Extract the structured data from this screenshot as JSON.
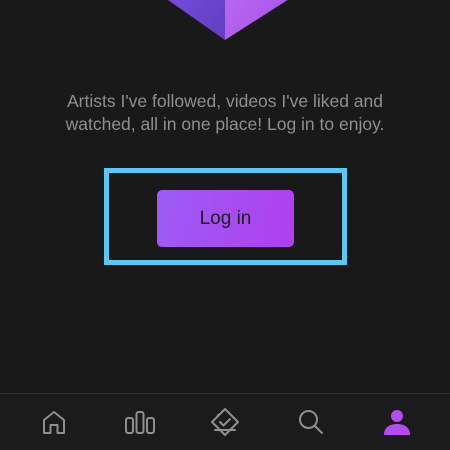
{
  "empty_state": {
    "message": "Artists I've followed, videos I've liked and watched, all in one place! Log in to enjoy."
  },
  "login": {
    "button_label": "Log in"
  },
  "tabbar": {
    "tabs": [
      {
        "id": "home",
        "icon": "home-icon",
        "active": false
      },
      {
        "id": "charts",
        "icon": "bar-chart-icon",
        "active": false
      },
      {
        "id": "tickets",
        "icon": "ticket-check-icon",
        "active": false
      },
      {
        "id": "search",
        "icon": "search-icon",
        "active": false
      },
      {
        "id": "profile",
        "icon": "person-icon",
        "active": true
      }
    ]
  },
  "colors": {
    "background": "#1a1919",
    "accent": "#a64ef0",
    "highlight_border": "#5ac8f0",
    "text_muted": "#8e8e93",
    "icon_inactive": "#8e8e93"
  }
}
